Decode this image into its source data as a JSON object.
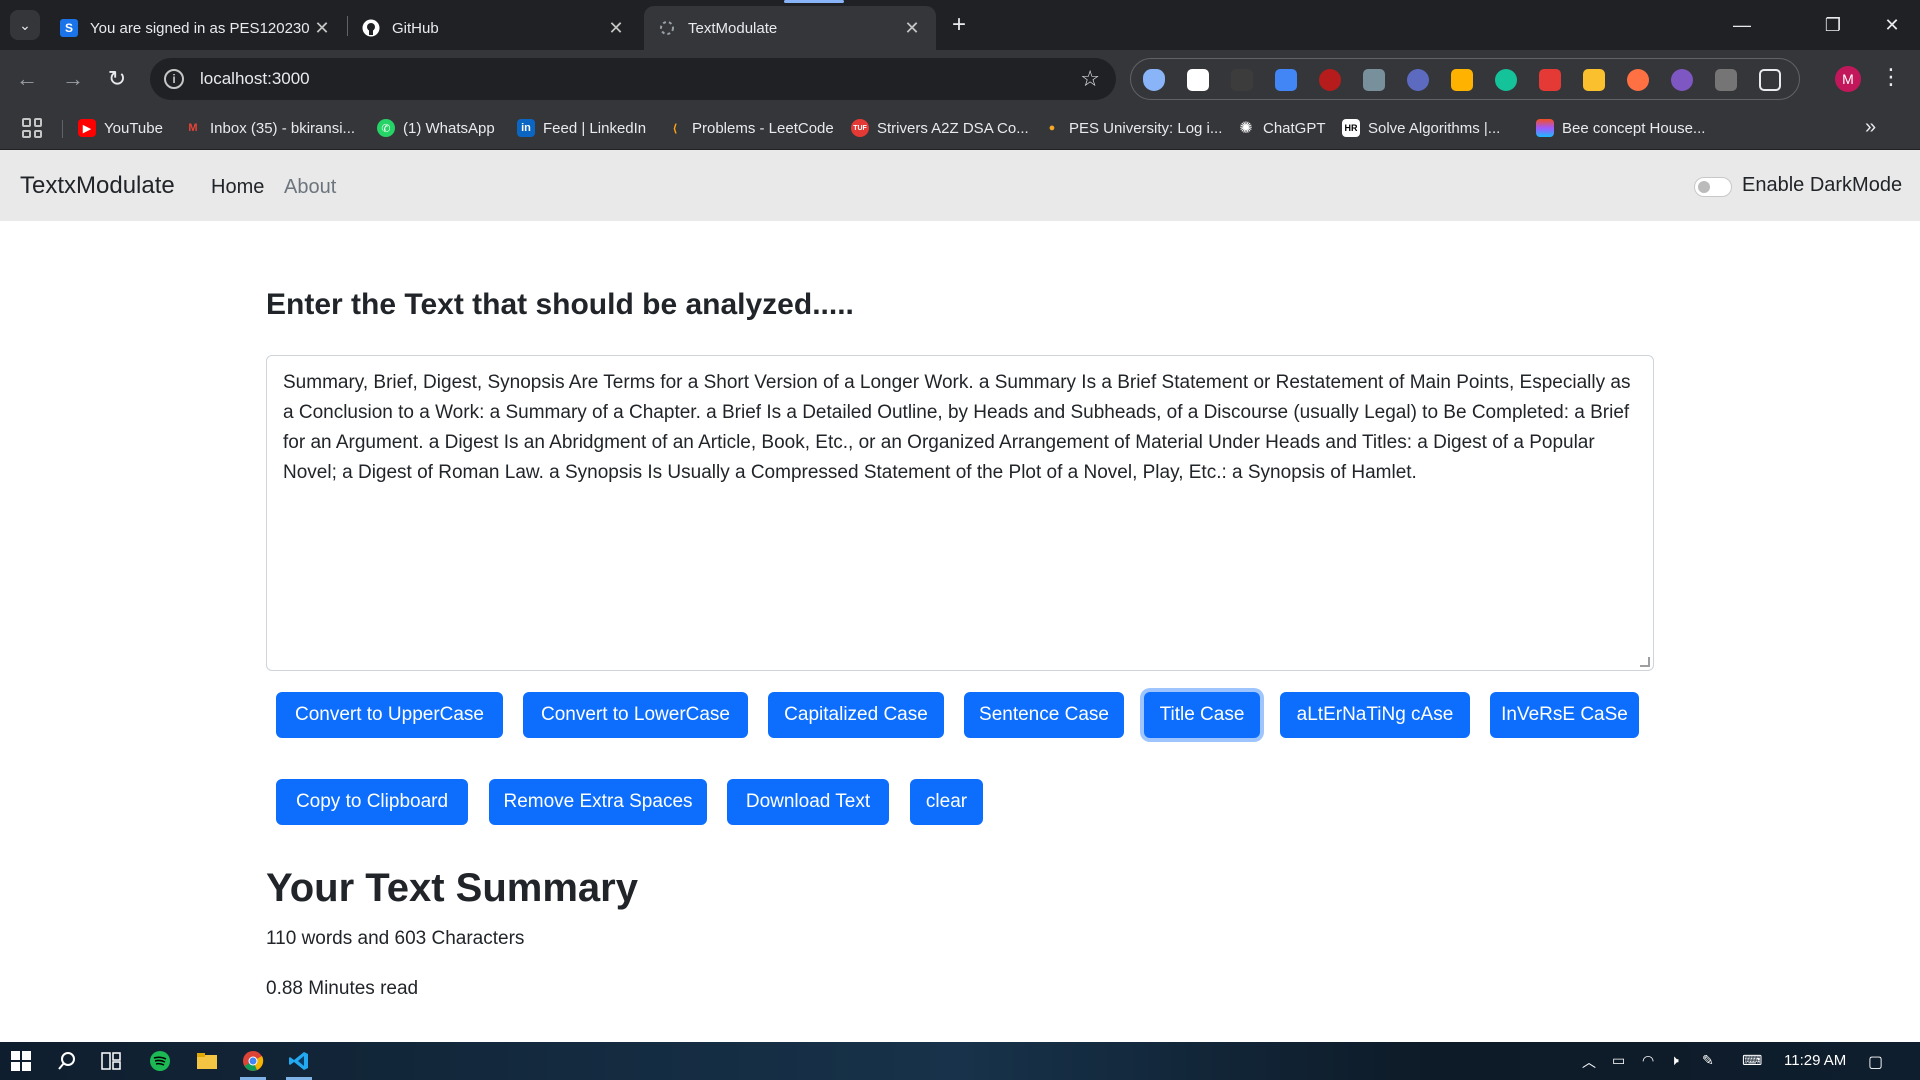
{
  "browser": {
    "tabs": [
      {
        "title": "You are signed in as PES120230",
        "favicon": "S",
        "favicon_color": "#1a73e8"
      },
      {
        "title": "GitHub",
        "favicon": "github-icon",
        "favicon_color": "#ffffff"
      },
      {
        "title": "TextModulate",
        "favicon": "loading-icon",
        "favicon_color": "#9aa0a6"
      }
    ],
    "url": "localhost:3000",
    "bookmarks": [
      {
        "label": "YouTube",
        "icon": "youtube-icon",
        "color": "#ff0000"
      },
      {
        "label": "Inbox (35) - bkiransi...",
        "icon": "gmail-icon",
        "color": "#ea4335"
      },
      {
        "label": "(1) WhatsApp",
        "icon": "whatsapp-icon",
        "color": "#25d366"
      },
      {
        "label": "Feed | LinkedIn",
        "icon": "linkedin-icon",
        "color": "#0a66c2"
      },
      {
        "label": "Problems - LeetCode",
        "icon": "leetcode-icon",
        "color": "#ffa116"
      },
      {
        "label": "Strivers A2Z DSA Co...",
        "icon": "tuf-icon",
        "color": "#e53935"
      },
      {
        "label": "PES University: Log i...",
        "icon": "pes-icon",
        "color": "#f9a825"
      },
      {
        "label": "ChatGPT",
        "icon": "chatgpt-icon",
        "color": "#ffffff"
      },
      {
        "label": "Solve Algorithms |...",
        "icon": "hackerrank-icon",
        "color": "#000000"
      },
      {
        "label": "Bee concept House...",
        "icon": "figma-icon",
        "color": "#f24e1e"
      }
    ],
    "profile_initial": "M"
  },
  "app": {
    "brand": "TextxModulate",
    "nav": {
      "home": "Home",
      "about": "About"
    },
    "darkmode_label": "Enable DarkMode"
  },
  "main": {
    "heading": "Enter the Text that should be analyzed.....",
    "textarea_value": "Summary, Brief, Digest, Synopsis Are Terms for a Short Version of a Longer Work. a Summary Is a Brief Statement or Restatement of Main Points, Especially as a Conclusion to a Work: a Summary of a Chapter. a Brief Is a Detailed Outline, by Heads and Subheads, of a Discourse (usually Legal) to Be Completed: a Brief for an Argument. a Digest Is an Abridgment of an Article, Book, Etc., or an Organized Arrangement of Material Under Heads and Titles: a Digest of a Popular Novel; a Digest of Roman Law. a Synopsis Is Usually a Compressed Statement of the Plot of a Novel, Play, Etc.: a Synopsis of Hamlet.",
    "buttons_row1": [
      "Convert to UpperCase",
      "Convert to LowerCase",
      "Capitalized Case",
      "Sentence Case",
      "Title Case",
      "aLtErNaTiNg cAse",
      "InVeRsE CaSe"
    ],
    "buttons_row2": [
      "Copy to Clipboard",
      "Remove Extra Spaces",
      "Download Text",
      "clear"
    ],
    "summary_heading": "Your Text Summary",
    "counts": "110 words and 603 Characters",
    "read_time": "0.88 Minutes read"
  },
  "taskbar": {
    "time": "11:29 AM"
  },
  "colors": {
    "primary": "#0d6efd",
    "navbar_bg": "#e9e9e9"
  }
}
